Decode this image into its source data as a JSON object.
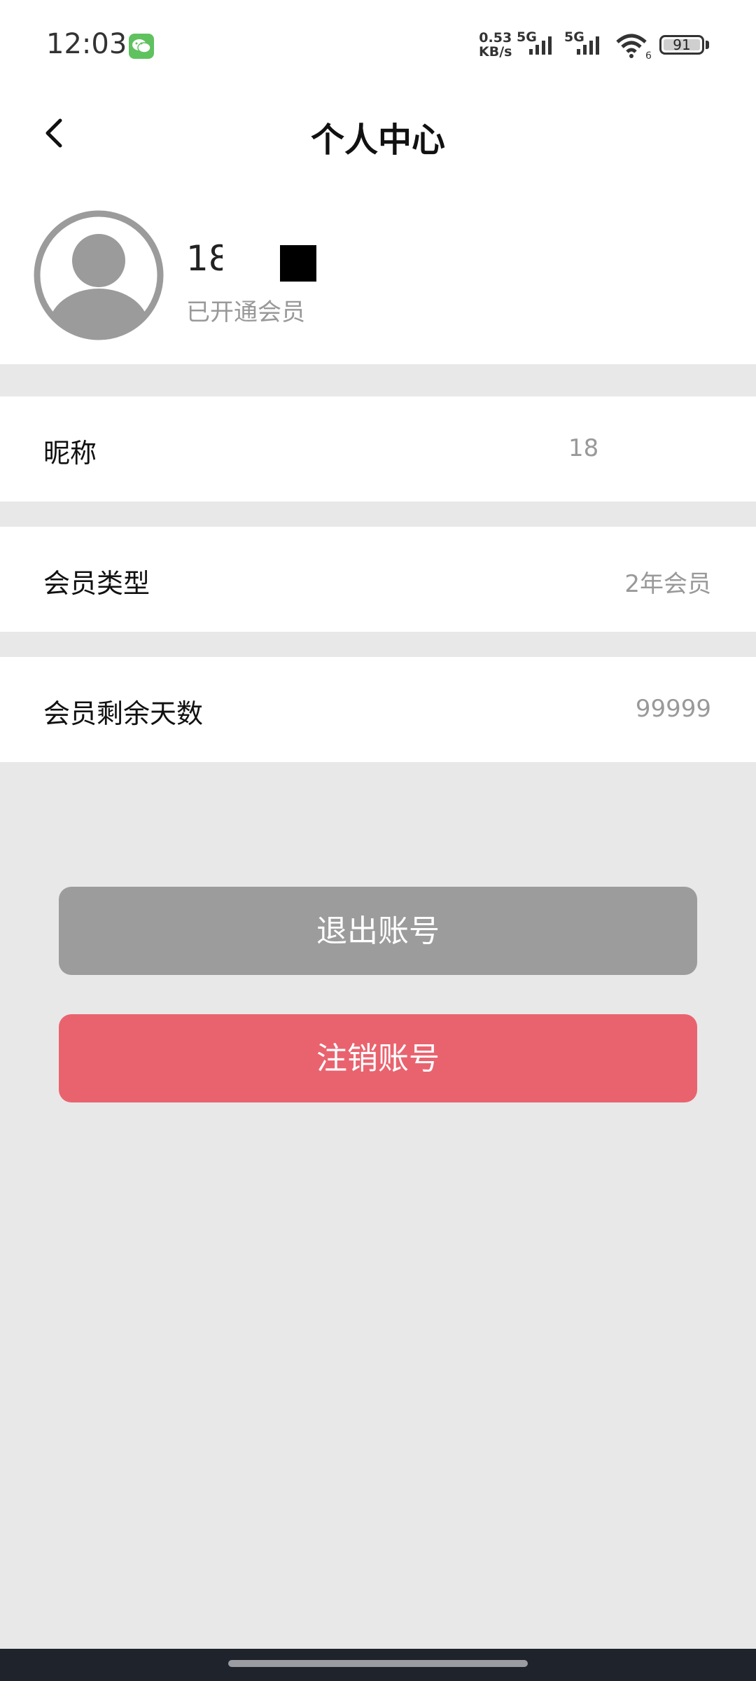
{
  "status_bar": {
    "time": "12:03",
    "net_speed": "0.53",
    "net_unit": "KB/s",
    "sim1": "5G",
    "sim2": "5G",
    "wifi_badge": "6",
    "battery": "91"
  },
  "header": {
    "title": "个人中心"
  },
  "profile": {
    "user_id": "18",
    "membership_status": "已开通会员"
  },
  "rows": [
    {
      "label": "昵称",
      "value": "18"
    },
    {
      "label": "会员类型",
      "value": "2年会员"
    },
    {
      "label": "会员剩余天数",
      "value": "99999"
    }
  ],
  "buttons": {
    "logout": "退出账号",
    "cancel_account": "注销账号"
  },
  "colors": {
    "background": "#e8e8e8",
    "logout_button": "#9c9c9c",
    "cancel_button": "#e9636f"
  }
}
